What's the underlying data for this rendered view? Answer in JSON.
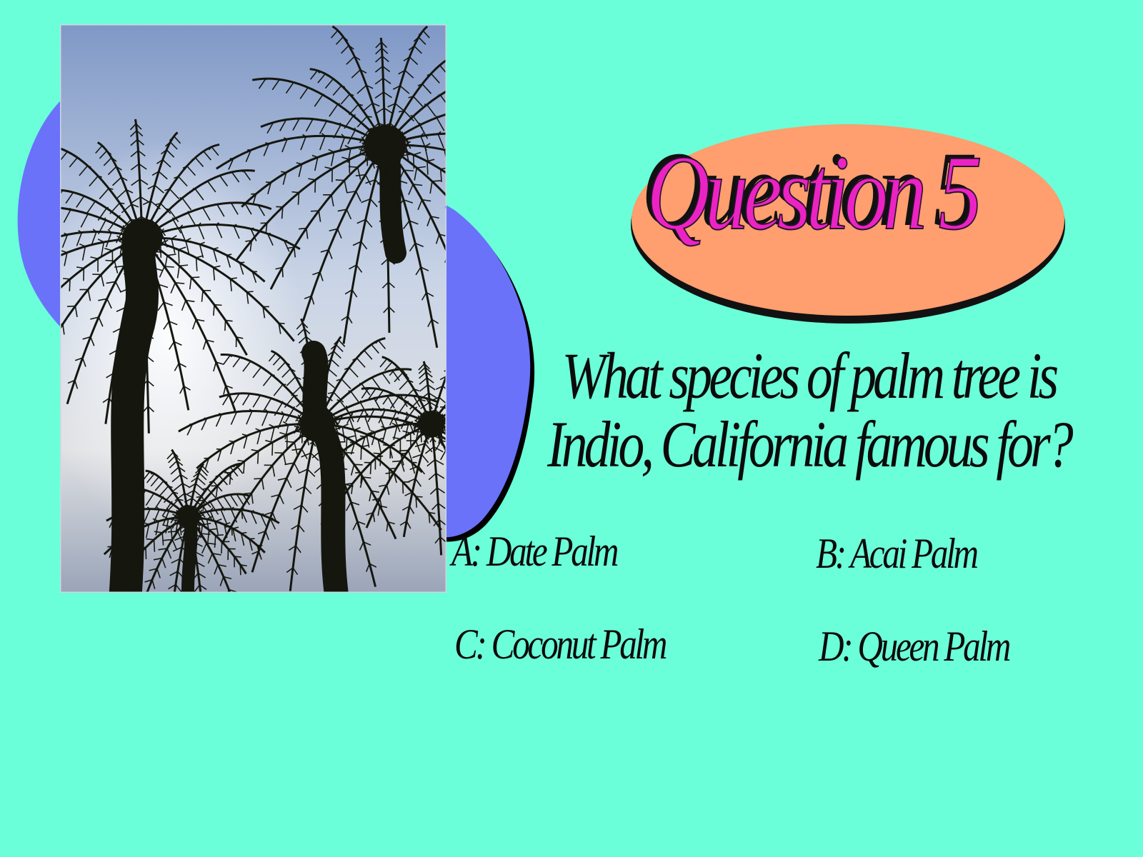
{
  "colors": {
    "background": "#6bffd9",
    "blob": "#6a72fa",
    "title_badge": "#ff9e6e",
    "title_text": "#ec23c3",
    "text": "#0b0b0b"
  },
  "photo": {
    "icon": "palm-trees-photo",
    "subject": "silhouetted palm trees against sky"
  },
  "title": "Question 5",
  "question": {
    "line1": "What species of palm tree is",
    "line2": "Indio, California famous for?"
  },
  "answers": [
    {
      "label": "A: Date Palm"
    },
    {
      "label": "B: Acai Palm"
    },
    {
      "label": "C: Coconut Palm"
    },
    {
      "label": "D: Queen Palm"
    }
  ]
}
